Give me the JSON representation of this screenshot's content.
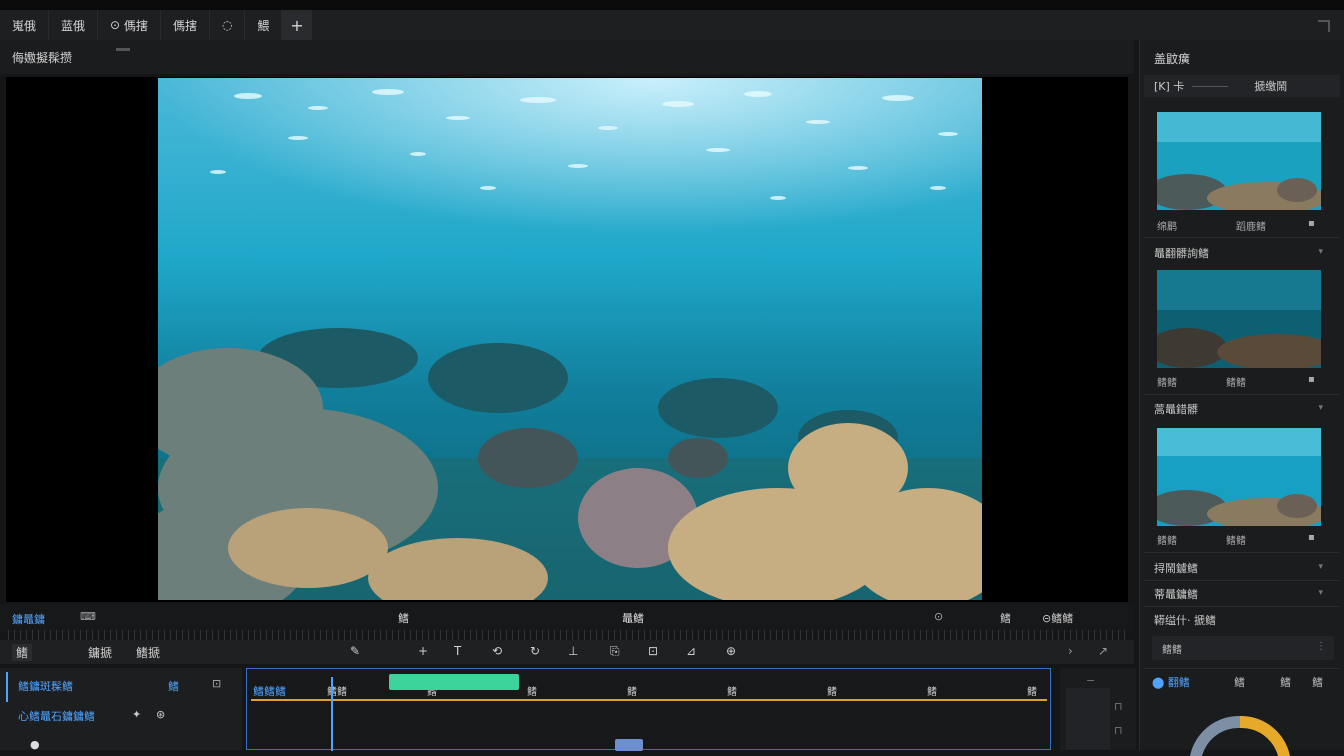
{
  "menu": {
    "items": [
      "嵬俄",
      "蓝俄",
      "傌搳",
      "傌搳"
    ],
    "icon_a": "◌",
    "icon_b": "鰃",
    "plus": "+"
  },
  "viewer": {
    "title": "侮嫐擬髹攒"
  },
  "sidebar": {
    "title": "盖鼤癀",
    "tab_left": "[K] 卡",
    "tab_right": "搋缴鬧",
    "cards": [
      {
        "label_left": "绵鹛",
        "label_right": "蹈鹿鳍",
        "section": "鼂翻髒詢鳍"
      },
      {
        "label_left": "鳍鳍",
        "label_right": "鳍鳍",
        "section": "蒿鼂錯髒"
      },
      {
        "label_left": "鳍鳍",
        "label_right": "鳍鳍",
        "section": ""
      }
    ],
    "rows": [
      "挦鬧鑢鳍",
      "蒂鼂鏞鳍",
      "鞯缢什·  搋鳍"
    ],
    "field": "鳍鳍",
    "bottom_tab": "翻鳍",
    "bottom_icons": [
      "鳍",
      "鳍",
      "鳍"
    ]
  },
  "transport": {
    "left_label": "鏞鼂鏞",
    "left_icon": "⌨",
    "center_label": "鳍",
    "right_label": "鼂鳍",
    "right_icons": [
      "⊙",
      "⊝鳍鳍",
      "鳍"
    ]
  },
  "toolbar": {
    "btn1": "鳍",
    "btn2": "鏞搋",
    "btn3": "鳍搋",
    "tools": [
      "✎",
      "+",
      "T",
      "⟲",
      "↻",
      "⊥",
      "⎘",
      "⊡",
      "⊿",
      "⊕"
    ]
  },
  "timeline": {
    "track_title": "鳍鏞斑髹鳍",
    "track_icon": "鳍",
    "track_sub": "心鳍鼂石鏞鏞鳍",
    "ticks": [
      "鳍鳍",
      "鳍",
      "鳍",
      "鳍",
      "鳍",
      "鳍",
      "鳍",
      "鳍",
      "鳍",
      "鳍"
    ],
    "header_label": "鳍鳍鳍"
  },
  "colors": {
    "accent": "#4ea3ff",
    "clip": "#3bd39a",
    "playhead": "#4ea3ff",
    "track": "#e0a030"
  }
}
